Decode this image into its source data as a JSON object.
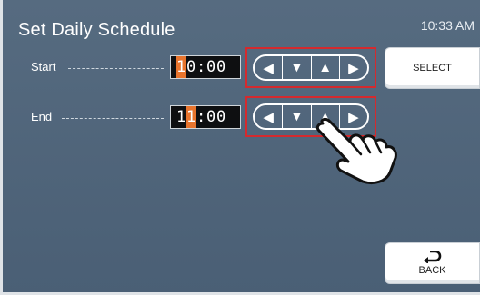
{
  "header": {
    "title": "Set Daily Schedule",
    "clock": "10:33 AM"
  },
  "rows": [
    {
      "label": "Start",
      "time_digits": [
        "1",
        "0",
        ":",
        "0",
        "0"
      ],
      "cursor_index": 0,
      "arrows": [
        "◀",
        "▼",
        "▲",
        "▶"
      ]
    },
    {
      "label": "End",
      "time_digits": [
        "1",
        "1",
        ":",
        "0",
        "0"
      ],
      "cursor_index": 1,
      "arrows": [
        "◀",
        "▼",
        "▲",
        "▶"
      ]
    }
  ],
  "buttons": {
    "select_label": "SELECT",
    "back_label": "BACK",
    "back_icon": "return-arrow-icon"
  },
  "colors": {
    "background": "#566b80",
    "cursor": "#e8742d",
    "highlight": "#d42a2e"
  }
}
